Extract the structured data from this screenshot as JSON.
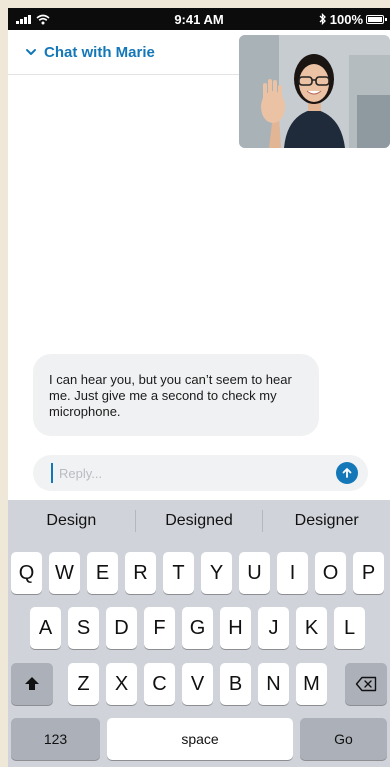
{
  "status_bar": {
    "time": "9:41 AM",
    "battery": "100%",
    "icons": [
      "signal-icon",
      "wifi-icon",
      "bluetooth-icon",
      "battery-icon"
    ]
  },
  "header": {
    "title": "Chat with Marie",
    "icon": "chevron-down-icon"
  },
  "video": {
    "icon": "video-thumbnail"
  },
  "messages": [
    {
      "text": "I can hear you, but you can’t seem to hear me. Just give me a second to check my microphone."
    }
  ],
  "reply": {
    "placeholder": "Reply...",
    "send_icon": "arrow-up-icon"
  },
  "keyboard": {
    "suggestions": [
      "Design",
      "Designed",
      "Designer"
    ],
    "row1": [
      "Q",
      "W",
      "E",
      "R",
      "T",
      "Y",
      "U",
      "I",
      "O",
      "P"
    ],
    "row2": [
      "A",
      "S",
      "D",
      "F",
      "G",
      "H",
      "J",
      "K",
      "L"
    ],
    "row3": [
      "Z",
      "X",
      "C",
      "V",
      "B",
      "N",
      "M"
    ],
    "shift_icon": "shift-icon",
    "backspace_icon": "backspace-icon",
    "numbers_label": "123",
    "space_label": "space",
    "go_label": "Go"
  },
  "colors": {
    "accent": "#1478b8",
    "keyboard_bg": "#d0d3d9",
    "bubble_bg": "#f0f1f3"
  }
}
